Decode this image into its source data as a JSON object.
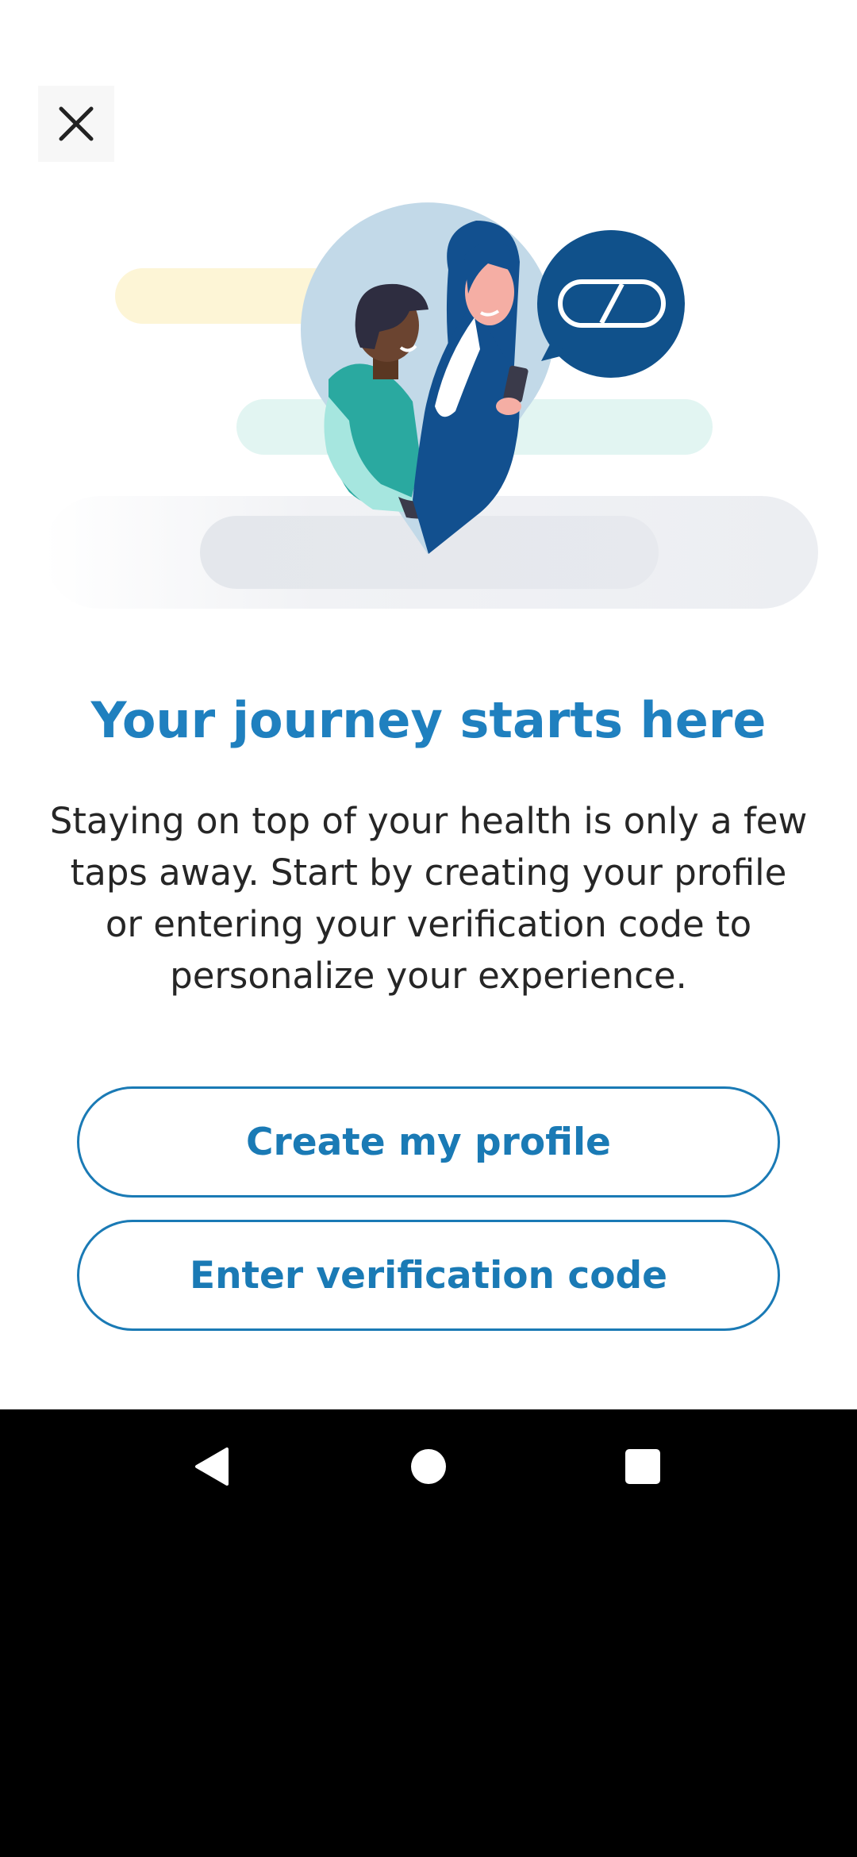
{
  "onboarding": {
    "title": "Your journey starts here",
    "description": "Staying on top of your health is only a few taps away. Start by creating your profile or entering your verification code to personalize your experience."
  },
  "actions": {
    "create_profile_label": "Create my profile",
    "verification_code_label": "Enter verification code"
  },
  "icons": {
    "close": "close-icon",
    "illustration": "people-location-pin-illustration",
    "pill": "pill-icon",
    "back": "back-icon",
    "home": "home-icon",
    "recents": "recents-icon"
  },
  "colors": {
    "accent": "#1f80bf",
    "button_border": "#1a7ab5",
    "text": "#262626",
    "speech_bubble": "#10518b",
    "pin": "#c2d9e8"
  }
}
